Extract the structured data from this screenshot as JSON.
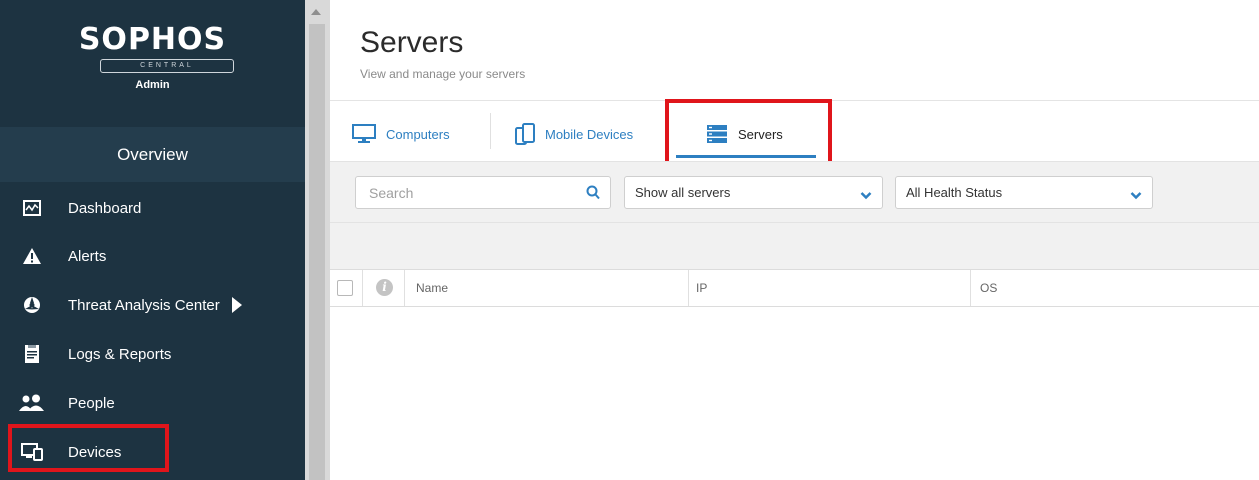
{
  "brand": {
    "name": "SOPHOS",
    "product": "CENTRAL",
    "role": "Admin"
  },
  "sidebar": {
    "section": "Overview",
    "items": [
      {
        "label": "Dashboard",
        "icon": "dashboard-icon"
      },
      {
        "label": "Alerts",
        "icon": "warning-icon"
      },
      {
        "label": "Threat Analysis Center",
        "icon": "biohazard-icon",
        "has_arrow": true
      },
      {
        "label": "Logs & Reports",
        "icon": "report-icon"
      },
      {
        "label": "People",
        "icon": "people-icon"
      },
      {
        "label": "Devices",
        "icon": "devices-icon",
        "highlighted": true
      }
    ]
  },
  "main": {
    "title": "Servers",
    "subtitle": "View and manage your servers",
    "tabs": [
      {
        "label": "Computers",
        "icon": "monitor-icon"
      },
      {
        "label": "Mobile Devices",
        "icon": "mobile-device-icon"
      },
      {
        "label": "Servers",
        "icon": "server-icon",
        "active": true
      }
    ],
    "search": {
      "placeholder": "Search",
      "value": ""
    },
    "filters": {
      "server_filter": "Show all servers",
      "health_filter": "All Health Status"
    },
    "table": {
      "columns": [
        "Name",
        "IP",
        "OS"
      ]
    }
  },
  "colors": {
    "sidebar_bg": "#1d3341",
    "accent": "#2d7fc1",
    "highlight": "#e0151b"
  }
}
